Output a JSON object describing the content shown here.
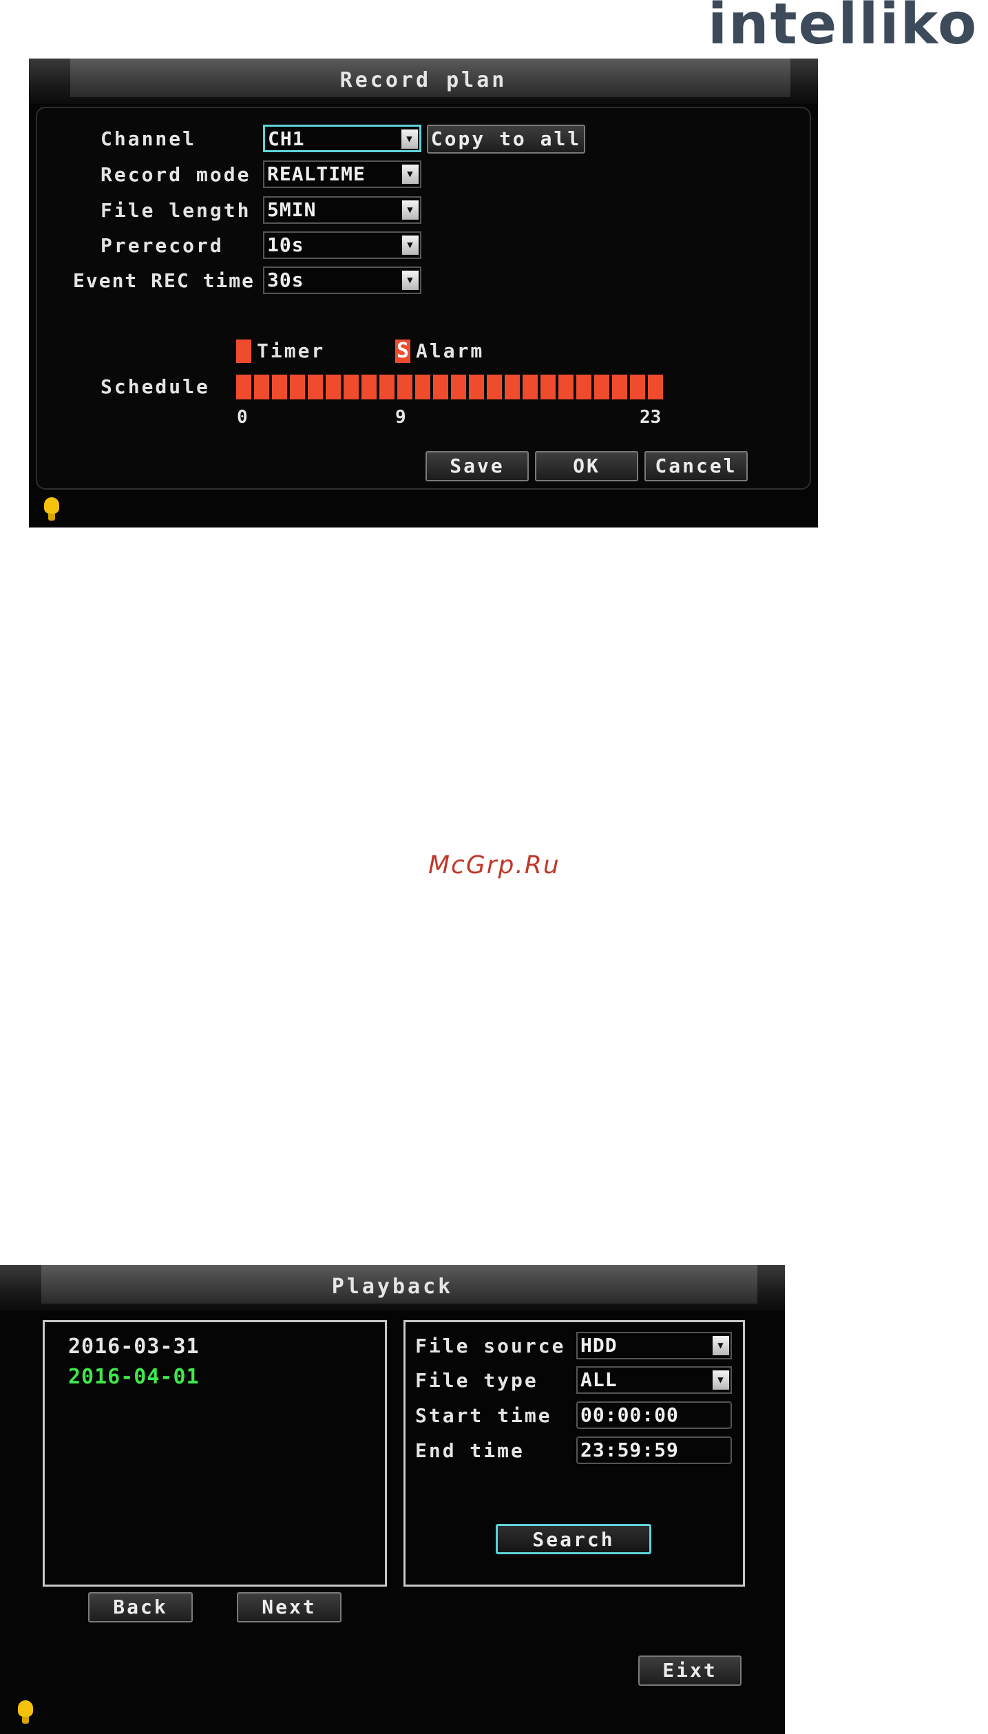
{
  "logo": "intelliko",
  "watermark": "McGrp.Ru",
  "record_plan": {
    "title": "Record plan",
    "fields": {
      "channel": {
        "label": "Channel",
        "value": "CH1"
      },
      "record_mode": {
        "label": "Record mode",
        "value": "REALTIME"
      },
      "file_length": {
        "label": "File length",
        "value": "5MIN"
      },
      "prerecord": {
        "label": "Prerecord",
        "value": "10s"
      },
      "event_rec_time": {
        "label": "Event REC time",
        "value": "30s"
      }
    },
    "copy_to_all": "Copy to all",
    "legend": {
      "timer": "Timer",
      "alarm_mark": "S",
      "alarm": "Alarm"
    },
    "schedule_label": "Schedule",
    "schedule_hours": 24,
    "schedule_color": "#ef4b2d",
    "ticks": {
      "start": "0",
      "mid": "9",
      "end": "23"
    },
    "buttons": {
      "save": "Save",
      "ok": "OK",
      "cancel": "Cancel"
    }
  },
  "playback": {
    "title": "Playback",
    "dates": [
      {
        "text": "2016-03-31",
        "color": "#e6e6e6"
      },
      {
        "text": "2016-04-01",
        "color": "#3ee84a"
      }
    ],
    "fields": {
      "file_source": {
        "label": "File source",
        "value": "HDD"
      },
      "file_type": {
        "label": "File type",
        "value": "ALL"
      },
      "start_time": {
        "label": "Start time",
        "value": "00:00:00"
      },
      "end_time": {
        "label": "End time",
        "value": "23:59:59"
      }
    },
    "search": "Search",
    "back": "Back",
    "next": "Next",
    "exit": "Eixt"
  },
  "icons": {
    "bulb": "lightbulb-icon",
    "dropdown": "dropdown-arrow-icon"
  }
}
